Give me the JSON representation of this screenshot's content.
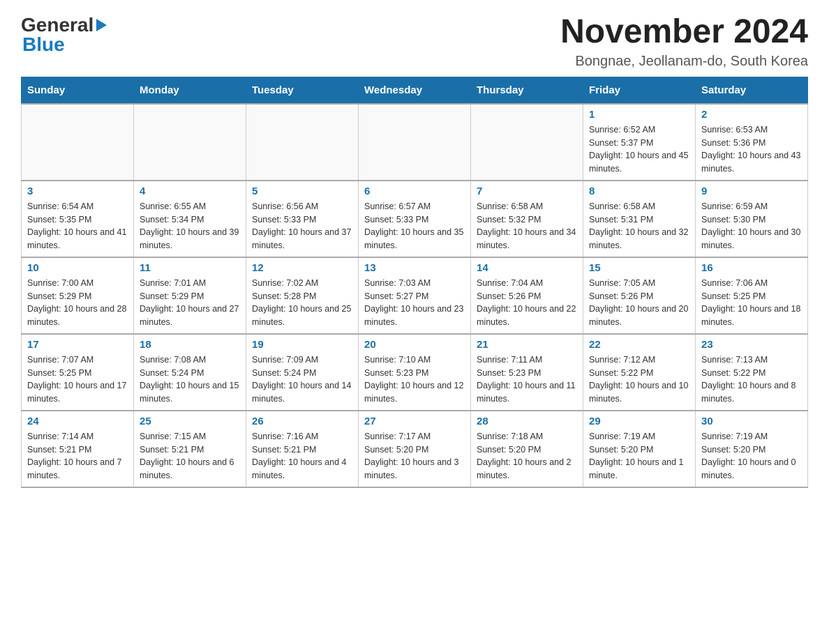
{
  "header": {
    "logo_general": "General",
    "logo_blue": "Blue",
    "month_title": "November 2024",
    "location": "Bongnae, Jeollanam-do, South Korea"
  },
  "days_of_week": [
    "Sunday",
    "Monday",
    "Tuesday",
    "Wednesday",
    "Thursday",
    "Friday",
    "Saturday"
  ],
  "weeks": [
    [
      {
        "day": "",
        "info": ""
      },
      {
        "day": "",
        "info": ""
      },
      {
        "day": "",
        "info": ""
      },
      {
        "day": "",
        "info": ""
      },
      {
        "day": "",
        "info": ""
      },
      {
        "day": "1",
        "info": "Sunrise: 6:52 AM\nSunset: 5:37 PM\nDaylight: 10 hours and 45 minutes."
      },
      {
        "day": "2",
        "info": "Sunrise: 6:53 AM\nSunset: 5:36 PM\nDaylight: 10 hours and 43 minutes."
      }
    ],
    [
      {
        "day": "3",
        "info": "Sunrise: 6:54 AM\nSunset: 5:35 PM\nDaylight: 10 hours and 41 minutes."
      },
      {
        "day": "4",
        "info": "Sunrise: 6:55 AM\nSunset: 5:34 PM\nDaylight: 10 hours and 39 minutes."
      },
      {
        "day": "5",
        "info": "Sunrise: 6:56 AM\nSunset: 5:33 PM\nDaylight: 10 hours and 37 minutes."
      },
      {
        "day": "6",
        "info": "Sunrise: 6:57 AM\nSunset: 5:33 PM\nDaylight: 10 hours and 35 minutes."
      },
      {
        "day": "7",
        "info": "Sunrise: 6:58 AM\nSunset: 5:32 PM\nDaylight: 10 hours and 34 minutes."
      },
      {
        "day": "8",
        "info": "Sunrise: 6:58 AM\nSunset: 5:31 PM\nDaylight: 10 hours and 32 minutes."
      },
      {
        "day": "9",
        "info": "Sunrise: 6:59 AM\nSunset: 5:30 PM\nDaylight: 10 hours and 30 minutes."
      }
    ],
    [
      {
        "day": "10",
        "info": "Sunrise: 7:00 AM\nSunset: 5:29 PM\nDaylight: 10 hours and 28 minutes."
      },
      {
        "day": "11",
        "info": "Sunrise: 7:01 AM\nSunset: 5:29 PM\nDaylight: 10 hours and 27 minutes."
      },
      {
        "day": "12",
        "info": "Sunrise: 7:02 AM\nSunset: 5:28 PM\nDaylight: 10 hours and 25 minutes."
      },
      {
        "day": "13",
        "info": "Sunrise: 7:03 AM\nSunset: 5:27 PM\nDaylight: 10 hours and 23 minutes."
      },
      {
        "day": "14",
        "info": "Sunrise: 7:04 AM\nSunset: 5:26 PM\nDaylight: 10 hours and 22 minutes."
      },
      {
        "day": "15",
        "info": "Sunrise: 7:05 AM\nSunset: 5:26 PM\nDaylight: 10 hours and 20 minutes."
      },
      {
        "day": "16",
        "info": "Sunrise: 7:06 AM\nSunset: 5:25 PM\nDaylight: 10 hours and 18 minutes."
      }
    ],
    [
      {
        "day": "17",
        "info": "Sunrise: 7:07 AM\nSunset: 5:25 PM\nDaylight: 10 hours and 17 minutes."
      },
      {
        "day": "18",
        "info": "Sunrise: 7:08 AM\nSunset: 5:24 PM\nDaylight: 10 hours and 15 minutes."
      },
      {
        "day": "19",
        "info": "Sunrise: 7:09 AM\nSunset: 5:24 PM\nDaylight: 10 hours and 14 minutes."
      },
      {
        "day": "20",
        "info": "Sunrise: 7:10 AM\nSunset: 5:23 PM\nDaylight: 10 hours and 12 minutes."
      },
      {
        "day": "21",
        "info": "Sunrise: 7:11 AM\nSunset: 5:23 PM\nDaylight: 10 hours and 11 minutes."
      },
      {
        "day": "22",
        "info": "Sunrise: 7:12 AM\nSunset: 5:22 PM\nDaylight: 10 hours and 10 minutes."
      },
      {
        "day": "23",
        "info": "Sunrise: 7:13 AM\nSunset: 5:22 PM\nDaylight: 10 hours and 8 minutes."
      }
    ],
    [
      {
        "day": "24",
        "info": "Sunrise: 7:14 AM\nSunset: 5:21 PM\nDaylight: 10 hours and 7 minutes."
      },
      {
        "day": "25",
        "info": "Sunrise: 7:15 AM\nSunset: 5:21 PM\nDaylight: 10 hours and 6 minutes."
      },
      {
        "day": "26",
        "info": "Sunrise: 7:16 AM\nSunset: 5:21 PM\nDaylight: 10 hours and 4 minutes."
      },
      {
        "day": "27",
        "info": "Sunrise: 7:17 AM\nSunset: 5:20 PM\nDaylight: 10 hours and 3 minutes."
      },
      {
        "day": "28",
        "info": "Sunrise: 7:18 AM\nSunset: 5:20 PM\nDaylight: 10 hours and 2 minutes."
      },
      {
        "day": "29",
        "info": "Sunrise: 7:19 AM\nSunset: 5:20 PM\nDaylight: 10 hours and 1 minute."
      },
      {
        "day": "30",
        "info": "Sunrise: 7:19 AM\nSunset: 5:20 PM\nDaylight: 10 hours and 0 minutes."
      }
    ]
  ]
}
